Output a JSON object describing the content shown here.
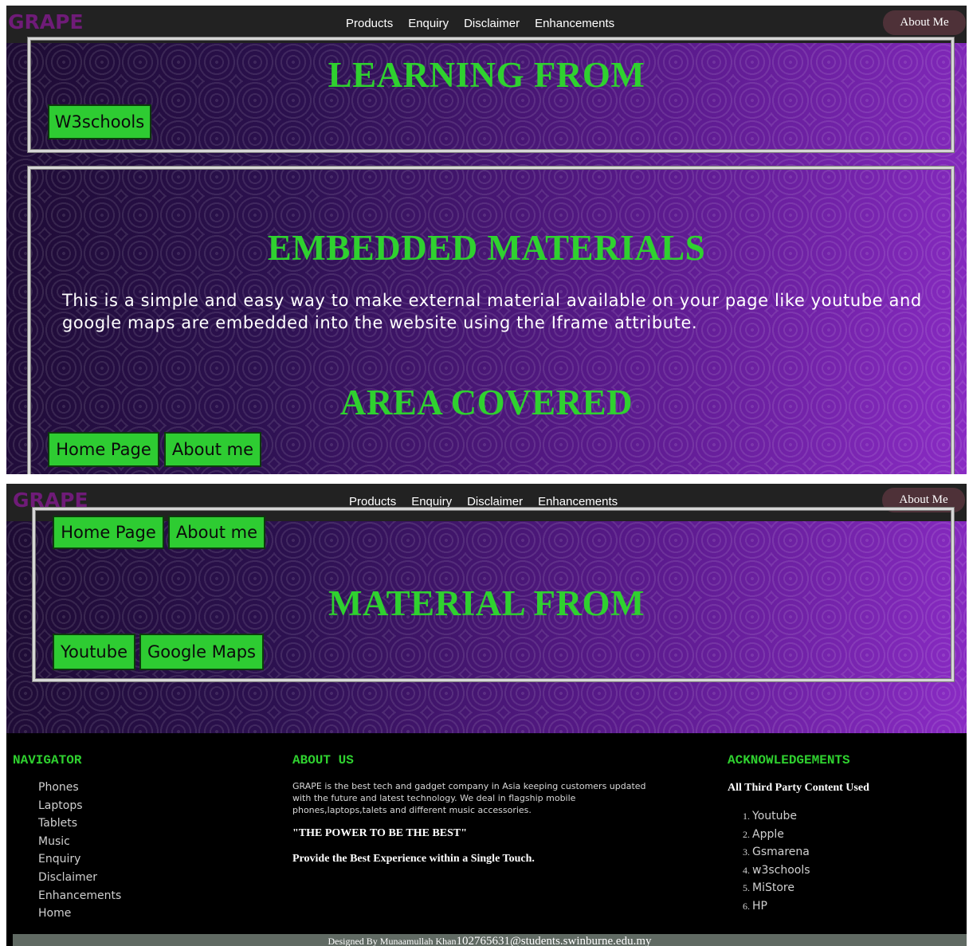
{
  "nav": {
    "logo": "GRAPE",
    "links": [
      "Products",
      "Enquiry",
      "Disclaimer",
      "Enhancements"
    ],
    "about_button": "About Me"
  },
  "learning": {
    "title": "LEARNING FROM",
    "buttons": [
      "W3schools"
    ]
  },
  "embedded": {
    "title": "EMBEDDED MATERIALS",
    "text": "This is a simple and easy way to make external material available on your page like youtube and google maps are embedded into the website using the Iframe attribute."
  },
  "area": {
    "title": "AREA COVERED",
    "buttons": [
      "Home Page",
      "About me"
    ]
  },
  "material": {
    "title": "MATERIAL FROM",
    "buttons": [
      "Youtube",
      "Google Maps"
    ]
  },
  "footer": {
    "navigator": {
      "heading": "NAVIGATOR",
      "items": [
        "Phones",
        "Laptops",
        "Tablets",
        "Music",
        "Enquiry",
        "Disclaimer",
        "Enhancements",
        "Home"
      ]
    },
    "about": {
      "heading": "ABOUT US",
      "text": "GRAPE is the best tech and gadget company in Asia keeping customers updated with the future and latest technology. We deal in flagship mobile phones,laptops,talets and different music accessories.",
      "quote": "\"THE POWER TO BE THE BEST\"",
      "tagline": "Provide the Best Experience within a Single Touch."
    },
    "ack": {
      "heading": "ACKNOWLEDGEMENTS",
      "subheading": "All Third Party Content Used",
      "items": [
        "Youtube",
        "Apple",
        "Gsmarena",
        "w3schools",
        "MiStore",
        "HP"
      ]
    },
    "credit": {
      "prefix": "Designed By Munaamullah Khan",
      "email": "102765631@students.swinburne.edu.my"
    }
  },
  "colors": {
    "accent_green": "#2fd12f",
    "logo_purple": "#6f1b78",
    "navbar": "#222222"
  }
}
